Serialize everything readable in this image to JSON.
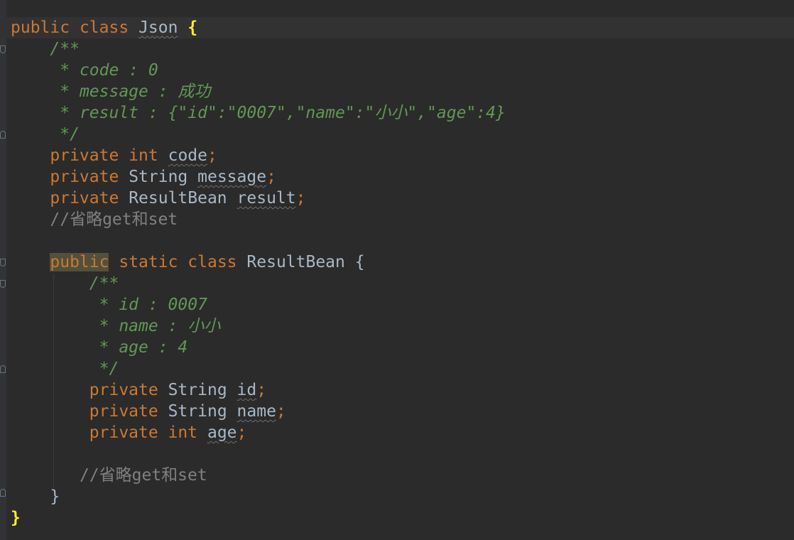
{
  "editor": {
    "colors": {
      "background": "#2b2b2b",
      "keyword": "#cc7832",
      "doc_comment": "#629755",
      "line_comment": "#808080",
      "text": "#a9b7c6",
      "brace_highlight": "#ffef28"
    },
    "lines": [
      {
        "tokens": [
          "public",
          "class",
          "Json",
          "{"
        ]
      },
      {
        "tokens": [
          "/**"
        ]
      },
      {
        "tokens": [
          "* code : 0"
        ]
      },
      {
        "tokens": [
          "* message : 成功"
        ]
      },
      {
        "tokens": [
          "* result : {\"id\":\"0007\",\"name\":\"小小\",\"age\":4}"
        ]
      },
      {
        "tokens": [
          "*/"
        ]
      },
      {
        "tokens": [
          "private",
          "int",
          "code",
          ";"
        ]
      },
      {
        "tokens": [
          "private",
          "String",
          "message",
          ";"
        ]
      },
      {
        "tokens": [
          "private",
          "ResultBean",
          "result",
          ";"
        ]
      },
      {
        "tokens": [
          "//省略get和set"
        ]
      },
      {
        "tokens": []
      },
      {
        "tokens": [
          "public",
          "static",
          "class",
          "ResultBean",
          "{"
        ]
      },
      {
        "tokens": [
          "/**"
        ]
      },
      {
        "tokens": [
          "* id : 0007"
        ]
      },
      {
        "tokens": [
          "* name : 小小"
        ]
      },
      {
        "tokens": [
          "* age : 4"
        ]
      },
      {
        "tokens": [
          "*/"
        ]
      },
      {
        "tokens": [
          "private",
          "String",
          "id",
          ";"
        ]
      },
      {
        "tokens": [
          "private",
          "String",
          "name",
          ";"
        ]
      },
      {
        "tokens": [
          "private",
          "int",
          "age",
          ";"
        ]
      },
      {
        "tokens": []
      },
      {
        "tokens": [
          "//省略get和set"
        ]
      },
      {
        "tokens": [
          "}"
        ]
      },
      {
        "tokens": [
          "}"
        ]
      }
    ]
  }
}
